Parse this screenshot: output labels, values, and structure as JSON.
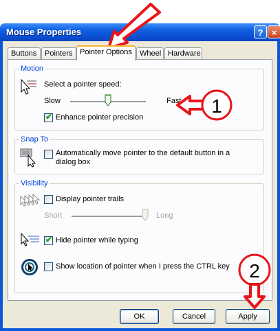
{
  "window": {
    "title": "Mouse Properties",
    "help_glyph": "?",
    "close_glyph": "×"
  },
  "tabs": [
    "Buttons",
    "Pointers",
    "Pointer Options",
    "Wheel",
    "Hardware"
  ],
  "motion": {
    "group_label": "Motion",
    "speed_label": "Select a pointer speed:",
    "slow_label": "Slow",
    "fast_label": "Fast",
    "speed_level": 0.5,
    "precision_label": "Enhance pointer precision",
    "precision_checked": true
  },
  "snap_to": {
    "group_label": "Snap To",
    "snap_label_line1": "Automatically move pointer to the default button in a",
    "snap_label_line2": "dialog box",
    "snap_checked": false
  },
  "visibility": {
    "group_label": "Visibility",
    "trails_label": "Display pointer trails",
    "trails_checked": false,
    "short_label": "Short",
    "long_label": "Long",
    "trail_level": 1.0,
    "hide_label": "Hide pointer while typing",
    "hide_checked": true,
    "ctrl_label": "Show location of pointer when I press the CTRL key",
    "ctrl_checked": false
  },
  "buttons": {
    "ok": "OK",
    "cancel": "Cancel",
    "apply": "Apply"
  },
  "annotations": {
    "callout_1": "1",
    "callout_2": "2",
    "color": "#e8151b"
  },
  "check_glyph": "✔"
}
